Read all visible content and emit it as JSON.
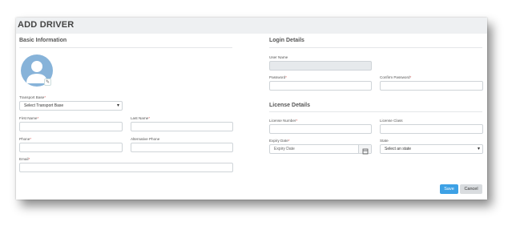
{
  "header": {
    "title": "ADD DRIVER"
  },
  "basic": {
    "section_title": "Basic Information",
    "transport_base": {
      "label": "Transport Base",
      "value": "Select Transport Base"
    },
    "first_name": {
      "label": "First Name"
    },
    "last_name": {
      "label": "Last Name"
    },
    "phone": {
      "label": "Phone"
    },
    "alt_phone": {
      "label": "Alternative Phone"
    },
    "email": {
      "label": "Email"
    }
  },
  "login": {
    "section_title": "Login Details",
    "user_name": {
      "label": "User Name"
    },
    "password": {
      "label": "Password"
    },
    "confirm_password": {
      "label": "Confirm Password"
    }
  },
  "license": {
    "section_title": "License Details",
    "number": {
      "label": "License Number"
    },
    "class": {
      "label": "License Class"
    },
    "expiry": {
      "label": "Expiry Date",
      "placeholder": "Expiry Date"
    },
    "state": {
      "label": "State",
      "value": "Select an state"
    }
  },
  "actions": {
    "save": "Save",
    "cancel": "Cancel"
  },
  "colors": {
    "accent": "#3da1e5",
    "required": "#d9534f",
    "avatar": "#87b3d9"
  }
}
